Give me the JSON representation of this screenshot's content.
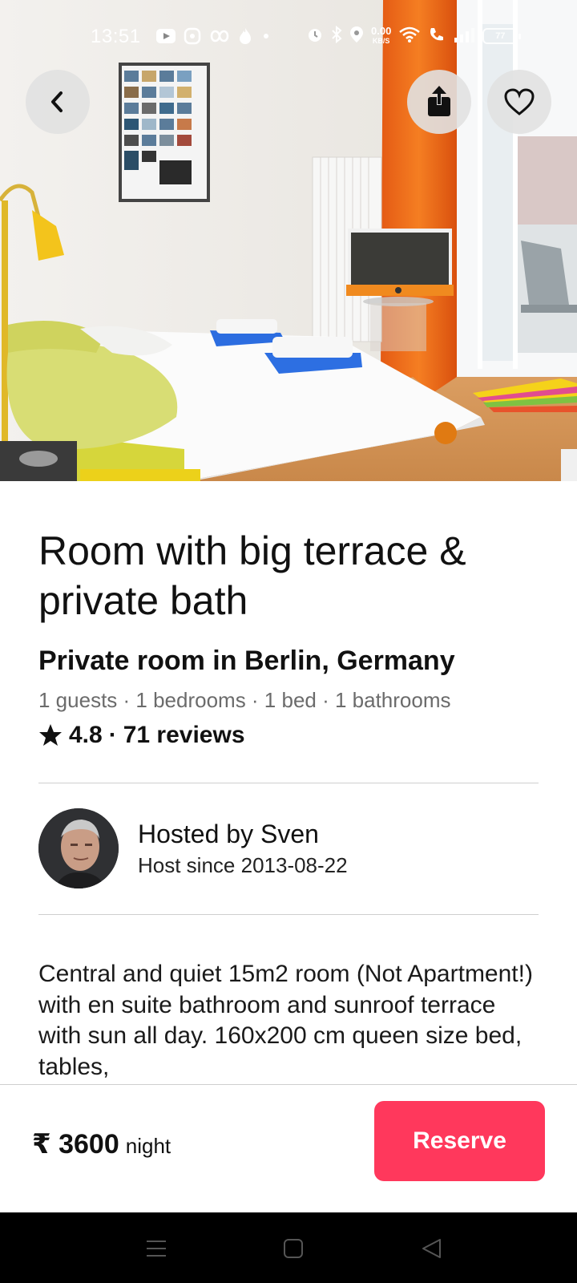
{
  "status_bar": {
    "time": "13:51",
    "speed_value": "0.00",
    "speed_unit": "KB/S",
    "battery": "77"
  },
  "icons": {
    "back": "chevron-left-icon",
    "share": "share-icon",
    "favorite": "heart-icon",
    "rating": "star-icon"
  },
  "listing": {
    "title": "Room with big terrace & private bath",
    "subtitle": "Private room in Berlin, Germany",
    "details": "1 guests · 1 bedrooms · 1 bed · 1 bathrooms",
    "rating": "4.8",
    "separator": "·",
    "reviews": "71 reviews"
  },
  "host": {
    "name_line": "Hosted by Sven",
    "since_line": "Host since 2013-08-22"
  },
  "description": "Central and quiet 15m2 room (Not Apartment!) with en suite bathroom and sunroof terrace with sun all day. 160x200 cm queen size bed, tables,",
  "booking": {
    "price": "₹ 3600",
    "unit": "night",
    "reserve_label": "Reserve"
  },
  "colors": {
    "accent": "#ff385c",
    "text": "#111111",
    "muted": "#6b6b6b"
  }
}
